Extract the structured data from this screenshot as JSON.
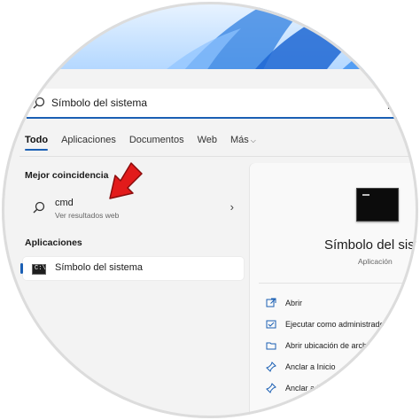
{
  "search": {
    "query": "Símbolo del sistema"
  },
  "tabs": [
    {
      "label": "Todo",
      "active": true
    },
    {
      "label": "Aplicaciones"
    },
    {
      "label": "Documentos"
    },
    {
      "label": "Web"
    },
    {
      "label": "Más",
      "has_dropdown": true
    }
  ],
  "left": {
    "best_match_title": "Mejor coincidencia",
    "best_match": {
      "title": "cmd",
      "subtitle": "Ver resultados web"
    },
    "apps_title": "Aplicaciones",
    "apps": [
      {
        "label": "Símbolo del sistema"
      }
    ]
  },
  "right": {
    "app_name": "Símbolo del sistema",
    "app_type": "Aplicación",
    "actions": [
      {
        "label": "Abrir",
        "icon": "open-external-icon"
      },
      {
        "label": "Ejecutar como administrador",
        "icon": "shield-icon"
      },
      {
        "label": "Abrir ubicación de archivo",
        "icon": "folder-icon"
      },
      {
        "label": "Anclar a Inicio",
        "icon": "pin-icon"
      },
      {
        "label": "Anclar a la barra de tareas",
        "icon": "pin-icon"
      }
    ]
  },
  "colors": {
    "accent": "#1a5fb4",
    "annotation_arrow": "#e21b1b",
    "panel": "#f3f3f3"
  }
}
